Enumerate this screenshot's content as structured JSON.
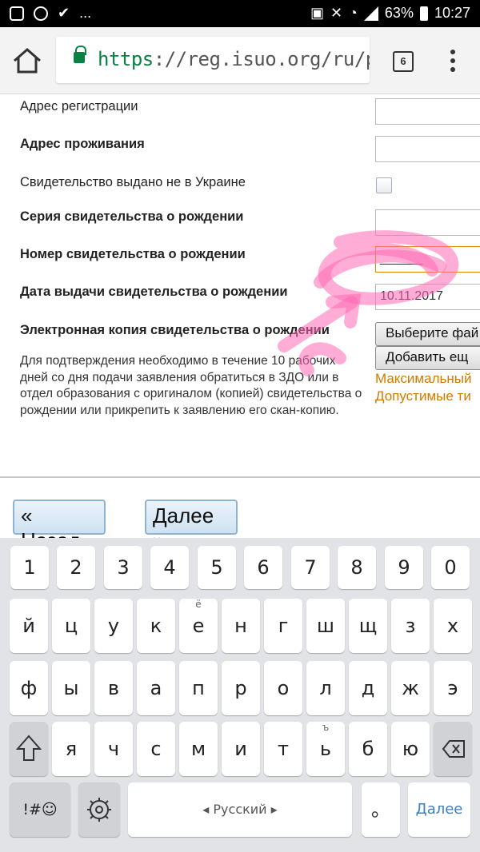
{
  "status_bar": {
    "battery": "63%",
    "time": "10:27",
    "more": "..."
  },
  "browser": {
    "url_scheme": "https",
    "url_rest": "://reg.isuo.org/ru/pare",
    "tab_count": "6"
  },
  "form": {
    "fields": [
      {
        "label": "Адрес регистрации"
      },
      {
        "label": "Адрес проживания"
      },
      {
        "label": "Свидетельство выдано не в Украине"
      },
      {
        "label": "Серия свидетельства о рождении"
      },
      {
        "label": "Номер свидетельства о рождении",
        "value": "______"
      },
      {
        "label": "Дата выдачи свидетельства о рождении",
        "value": "10.11.2017"
      },
      {
        "label": "Электронная копия свидетельства о рождении"
      }
    ],
    "choose_file_label": "Выберите фай",
    "add_more_label": "Добавить ещ",
    "max_size_text": "Максимальный",
    "allowed_types_text": "Допустимые ти",
    "hint": "Для подтверждения необходимо в течение 10 рабочих дней со дня подачи заявления обратиться в ЗДО или в отдел образования с оригиналом (копией) свидетельства о рождении или прикрепить к заявлению его скан-копию."
  },
  "nav": {
    "back": "« Назад",
    "next": "Далее »"
  },
  "keyboard": {
    "row_digits": [
      "1",
      "2",
      "3",
      "4",
      "5",
      "6",
      "7",
      "8",
      "9",
      "0"
    ],
    "row1": [
      "й",
      "ц",
      "у",
      "к",
      "е",
      "н",
      "г",
      "ш",
      "щ",
      "з",
      "х"
    ],
    "row1_alt_e": "ё",
    "row2": [
      "ф",
      "ы",
      "в",
      "а",
      "п",
      "р",
      "о",
      "л",
      "д",
      "ж",
      "э"
    ],
    "row3": [
      "я",
      "ч",
      "с",
      "м",
      "и",
      "т",
      "ь",
      "б",
      "ю"
    ],
    "row3_alt_soft": "ъ",
    "symbols_key": "!#☺",
    "space_label": "Русский",
    "period_key": "。",
    "enter_label": "Далее"
  },
  "colors": {
    "link_green": "#0b8043",
    "accent_orange": "#d17a00",
    "enter_blue": "#3b7fc4",
    "scribble_pink": "#ff69b4"
  }
}
